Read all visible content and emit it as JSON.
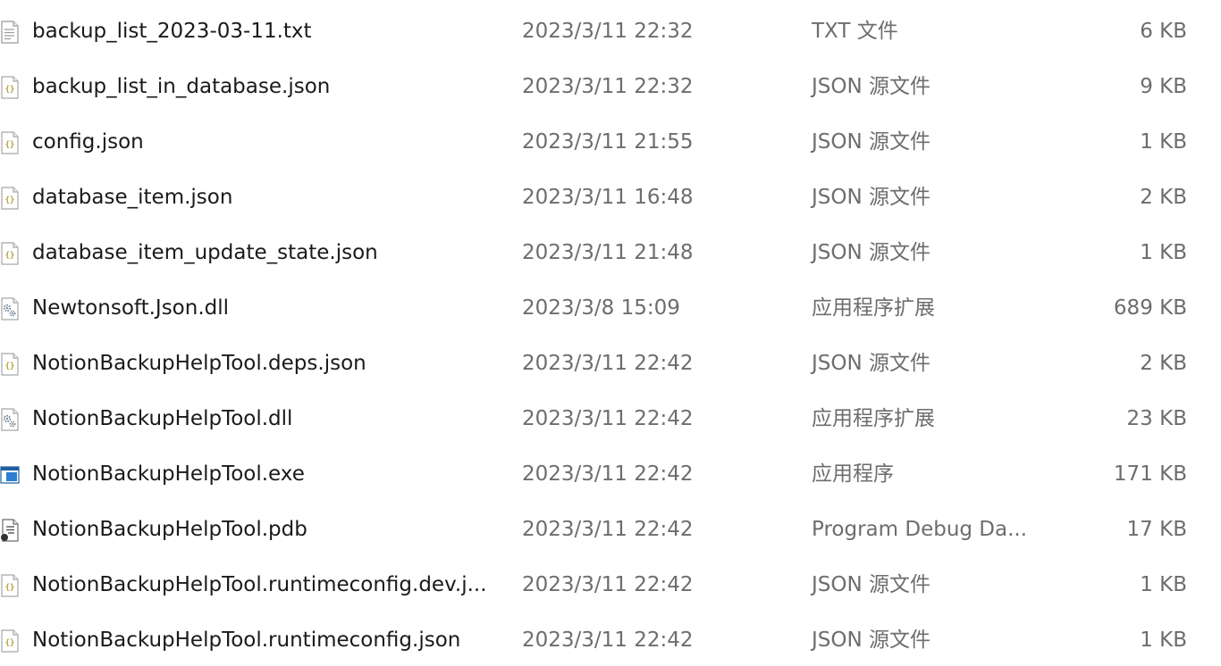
{
  "files": [
    {
      "name": "backup_list_2023-03-11.txt",
      "modified": "2023/3/11 22:32",
      "type": "TXT 文件",
      "size": "6 KB",
      "icon": "text-file-icon"
    },
    {
      "name": "backup_list_in_database.json",
      "modified": "2023/3/11 22:32",
      "type": "JSON 源文件",
      "size": "9 KB",
      "icon": "json-file-icon"
    },
    {
      "name": "config.json",
      "modified": "2023/3/11 21:55",
      "type": "JSON 源文件",
      "size": "1 KB",
      "icon": "json-file-icon"
    },
    {
      "name": "database_item.json",
      "modified": "2023/3/11 16:48",
      "type": "JSON 源文件",
      "size": "2 KB",
      "icon": "json-file-icon"
    },
    {
      "name": "database_item_update_state.json",
      "modified": "2023/3/11 21:48",
      "type": "JSON 源文件",
      "size": "1 KB",
      "icon": "json-file-icon"
    },
    {
      "name": "Newtonsoft.Json.dll",
      "modified": "2023/3/8 15:09",
      "type": "应用程序扩展",
      "size": "689 KB",
      "icon": "dll-file-icon"
    },
    {
      "name": "NotionBackupHelpTool.deps.json",
      "modified": "2023/3/11 22:42",
      "type": "JSON 源文件",
      "size": "2 KB",
      "icon": "json-file-icon"
    },
    {
      "name": "NotionBackupHelpTool.dll",
      "modified": "2023/3/11 22:42",
      "type": "应用程序扩展",
      "size": "23 KB",
      "icon": "dll-file-icon"
    },
    {
      "name": "NotionBackupHelpTool.exe",
      "modified": "2023/3/11 22:42",
      "type": "应用程序",
      "size": "171 KB",
      "icon": "exe-file-icon"
    },
    {
      "name": "NotionBackupHelpTool.pdb",
      "modified": "2023/3/11 22:42",
      "type": "Program Debug Da...",
      "size": "17 KB",
      "icon": "pdb-file-icon"
    },
    {
      "name": "NotionBackupHelpTool.runtimeconfig.dev.j...",
      "modified": "2023/3/11 22:42",
      "type": "JSON 源文件",
      "size": "1 KB",
      "icon": "json-file-icon"
    },
    {
      "name": "NotionBackupHelpTool.runtimeconfig.json",
      "modified": "2023/3/11 22:42",
      "type": "JSON 源文件",
      "size": "1 KB",
      "icon": "json-file-icon"
    }
  ]
}
